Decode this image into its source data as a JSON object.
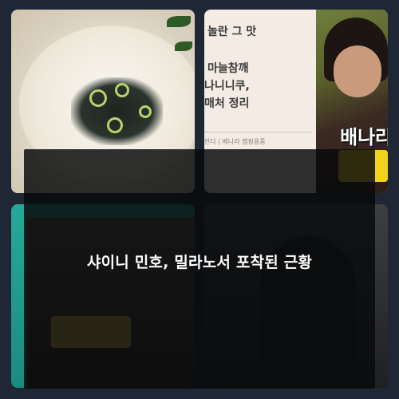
{
  "thumbnails": {
    "soup": {},
    "card": {
      "line1": "놀란 그 맛",
      "line2": "마늘참깨",
      "line3": "나니니쿠,",
      "line4": "매처 정리",
      "caption": "란다 | 배나라 캠핑용품",
      "promo": "배나라"
    },
    "teal": {},
    "dark": {}
  },
  "overlay": {
    "title": "샤이니 민호, 밀라노서 포착된 근황"
  },
  "colors": {
    "background": "#1e2733",
    "overlay": "#08090b",
    "overlay_text": "#ffffff",
    "teal_accent": "#26a99a"
  }
}
